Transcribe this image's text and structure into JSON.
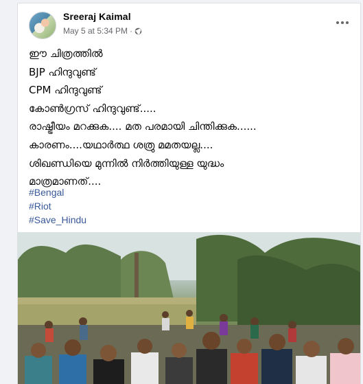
{
  "post": {
    "author": "Sreeraj Kaimal",
    "date": "May 5 at 5:34 PM",
    "separator": "·",
    "audience_icon": "globe-icon",
    "more_icon": "more-options-icon",
    "lines": [
      "ഈ ചിത്രത്തിൽ",
      " BJP ഹിന്ദുവുണ്ട്",
      "CPM ഹിന്ദുവുണ്ട്",
      "കോൺഗ്രസ് ഹിന്ദുവുണ്ട്.....",
      "രാഷ്ട്രീയം മറക്കുക.... മത പരമായി ചിന്തിക്കുക......",
      "കാരണം....യഥാർത്ഥ ശത്രു മമതയല്ല....",
      "ശിഖണ്ഡിയെ മുന്നിൽ നിർത്തിയുള്ള യുദ്ധം",
      "മാത്രമാണത്...."
    ],
    "hashtags": [
      "#Bengal",
      "#Riot",
      "#Save_Hindu"
    ]
  },
  "colors": {
    "link": "#385898",
    "text": "#050505",
    "meta": "#65676b"
  }
}
